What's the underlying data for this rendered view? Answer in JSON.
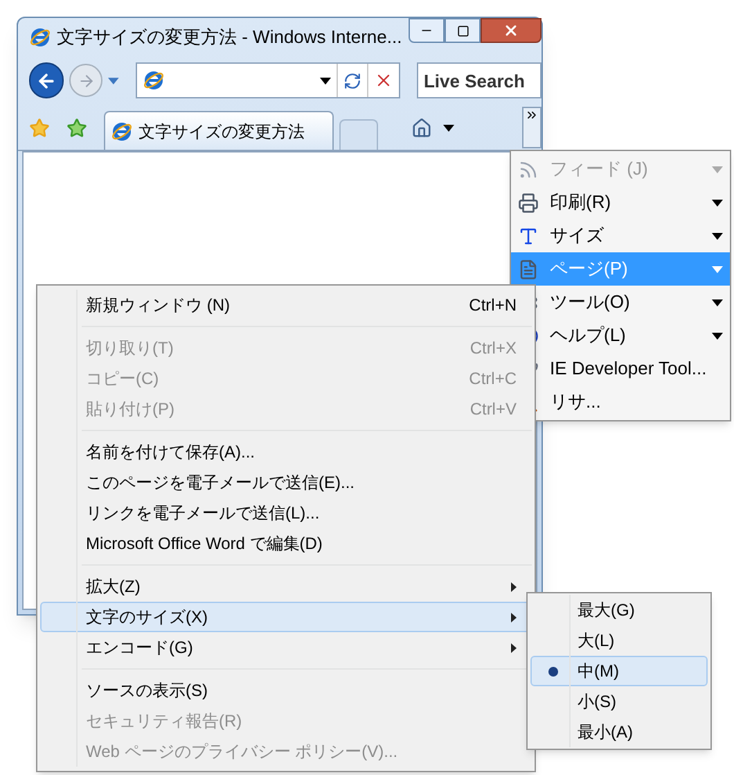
{
  "window": {
    "title": "文字サイズの変更方法 - Windows Interne...",
    "search_placeholder": "Live Search",
    "tab_title": "文字サイズの変更方法"
  },
  "command_menu": [
    {
      "label": "フィード (J)",
      "disabled": true,
      "selected": false,
      "submenu": true
    },
    {
      "label": "印刷(R)",
      "disabled": false,
      "selected": false,
      "submenu": true
    },
    {
      "label": "サイズ",
      "disabled": false,
      "selected": false,
      "submenu": true
    },
    {
      "label": "ページ(P)",
      "disabled": false,
      "selected": true,
      "submenu": true
    },
    {
      "label": "ツール(O)",
      "disabled": false,
      "selected": false,
      "submenu": true
    },
    {
      "label": "ヘルプ(L)",
      "disabled": false,
      "selected": false,
      "submenu": true
    },
    {
      "label": "IE Developer Tool...",
      "disabled": false,
      "selected": false,
      "submenu": false
    },
    {
      "label": "リサ...",
      "disabled": false,
      "selected": false,
      "submenu": false
    }
  ],
  "page_menu": [
    {
      "kind": "item",
      "label": "新規ウィンドウ (N)",
      "shortcut": "Ctrl+N",
      "disabled": false,
      "selected": false,
      "submenu": false
    },
    {
      "kind": "separator"
    },
    {
      "kind": "item",
      "label": "切り取り(T)",
      "shortcut": "Ctrl+X",
      "disabled": true,
      "selected": false,
      "submenu": false
    },
    {
      "kind": "item",
      "label": "コピー(C)",
      "shortcut": "Ctrl+C",
      "disabled": true,
      "selected": false,
      "submenu": false
    },
    {
      "kind": "item",
      "label": "貼り付け(P)",
      "shortcut": "Ctrl+V",
      "disabled": true,
      "selected": false,
      "submenu": false
    },
    {
      "kind": "separator"
    },
    {
      "kind": "item",
      "label": "名前を付けて保存(A)...",
      "disabled": false,
      "selected": false,
      "submenu": false
    },
    {
      "kind": "item",
      "label": "このページを電子メールで送信(E)...",
      "disabled": false,
      "selected": false,
      "submenu": false
    },
    {
      "kind": "item",
      "label": "リンクを電子メールで送信(L)...",
      "disabled": false,
      "selected": false,
      "submenu": false
    },
    {
      "kind": "item",
      "label": "Microsoft Office Word で編集(D)",
      "disabled": false,
      "selected": false,
      "submenu": false
    },
    {
      "kind": "separator"
    },
    {
      "kind": "item",
      "label": "拡大(Z)",
      "disabled": false,
      "selected": false,
      "submenu": true
    },
    {
      "kind": "item",
      "label": "文字のサイズ(X)",
      "disabled": false,
      "selected": true,
      "submenu": true
    },
    {
      "kind": "item",
      "label": "エンコード(G)",
      "disabled": false,
      "selected": false,
      "submenu": true
    },
    {
      "kind": "separator"
    },
    {
      "kind": "item",
      "label": "ソースの表示(S)",
      "disabled": false,
      "selected": false,
      "submenu": false
    },
    {
      "kind": "item",
      "label": "セキュリティ報告(R)",
      "disabled": true,
      "selected": false,
      "submenu": false
    },
    {
      "kind": "item",
      "label": "Web ページのプライバシー ポリシー(V)...",
      "disabled": true,
      "selected": false,
      "submenu": false
    }
  ],
  "text_size_menu": [
    {
      "label": "最大(G)",
      "selected": false
    },
    {
      "label": "大(L)",
      "selected": false
    },
    {
      "label": "中(M)",
      "selected": true
    },
    {
      "label": "小(S)",
      "selected": false
    },
    {
      "label": "最小(A)",
      "selected": false
    }
  ]
}
